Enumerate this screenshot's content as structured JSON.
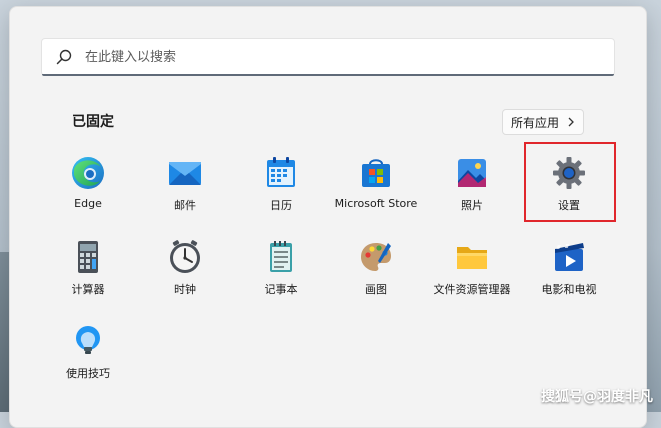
{
  "search": {
    "placeholder": "在此键入以搜索"
  },
  "pinned": {
    "title": "已固定",
    "all_apps_label": "所有应用",
    "apps": [
      {
        "label": "Edge",
        "icon": "edge-icon"
      },
      {
        "label": "邮件",
        "icon": "mail-icon"
      },
      {
        "label": "日历",
        "icon": "calendar-icon"
      },
      {
        "label": "Microsoft Store",
        "icon": "store-icon"
      },
      {
        "label": "照片",
        "icon": "photos-icon"
      },
      {
        "label": "设置",
        "icon": "gear-icon"
      },
      {
        "label": "计算器",
        "icon": "calculator-icon"
      },
      {
        "label": "时钟",
        "icon": "clock-icon"
      },
      {
        "label": "记事本",
        "icon": "notepad-icon"
      },
      {
        "label": "画图",
        "icon": "paint-icon"
      },
      {
        "label": "文件资源管理器",
        "icon": "folder-icon"
      },
      {
        "label": "电影和电视",
        "icon": "video-icon"
      },
      {
        "label": "使用技巧",
        "icon": "tips-icon"
      }
    ]
  },
  "watermark": "搜狐号@羽度非凡",
  "colors": {
    "highlight": "#e0262b",
    "accent": "#0078d4"
  }
}
